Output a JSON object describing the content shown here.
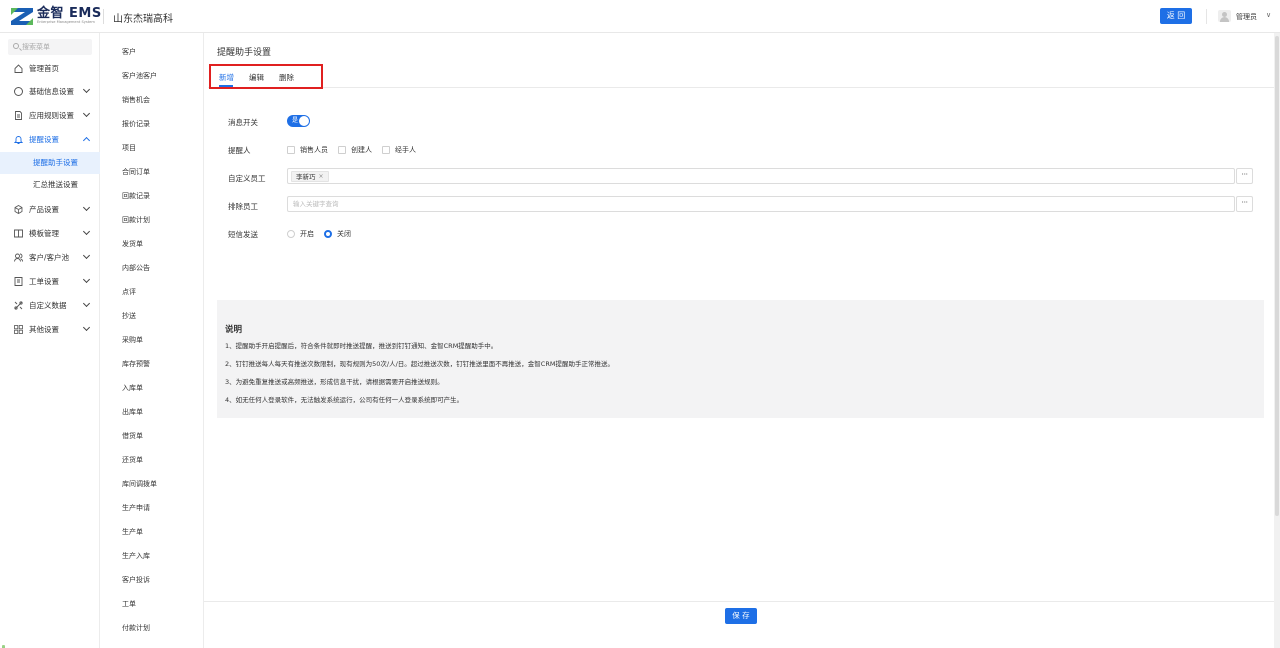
{
  "header": {
    "logo_main": "金智 EMS",
    "logo_sub": "Enterprise Management System",
    "company": "山东杰瑞高科",
    "back_label": "返 回",
    "user_name": "管理员",
    "user_caret": "∨"
  },
  "sidebar": {
    "search_placeholder": "搜索菜单",
    "items": [
      {
        "label": "管理首页",
        "icon": "home-icon"
      },
      {
        "label": "基础信息设置",
        "icon": "settings-circle-icon"
      },
      {
        "label": "应用规则设置",
        "icon": "document-icon"
      },
      {
        "label": "提醒设置",
        "icon": "bell-icon"
      },
      {
        "label": "产品设置",
        "icon": "cube-icon"
      },
      {
        "label": "模板管理",
        "icon": "template-icon"
      },
      {
        "label": "客户/客户池",
        "icon": "users-icon"
      },
      {
        "label": "工单设置",
        "icon": "ticket-icon"
      },
      {
        "label": "自定义数据",
        "icon": "custom-data-icon"
      },
      {
        "label": "其他设置",
        "icon": "grid-icon"
      }
    ],
    "sub_items": [
      "提醒助手设置",
      "汇总推送设置"
    ]
  },
  "midcol": {
    "items": [
      "客户",
      "客户池客户",
      "销售机会",
      "报价记录",
      "项目",
      "合同订单",
      "回款记录",
      "回款计划",
      "发货单",
      "内部公告",
      "点评",
      "抄送",
      "采购单",
      "库存预警",
      "入库单",
      "出库单",
      "借货单",
      "还货单",
      "库间调拨单",
      "生产申请",
      "生产单",
      "生产入库",
      "客户投诉",
      "工单",
      "付款计划"
    ]
  },
  "main": {
    "title": "提醒助手设置",
    "tabs": [
      "新增",
      "编辑",
      "删除"
    ],
    "form": {
      "switch_label": "消息开关",
      "switch_text": "是",
      "remind_label": "提醒人",
      "remind_options": [
        "销售人员",
        "创建人",
        "经手人"
      ],
      "custom_label": "自定义员工",
      "custom_tag": "李新巧",
      "tag_close": "×",
      "exclude_label": "排除员工",
      "exclude_placeholder": "输入关键字查询",
      "more_label": "···",
      "sms_label": "短信发送",
      "sms_options": [
        "开启",
        "关闭"
      ],
      "sms_selected": "关闭"
    },
    "notes": {
      "title": "说明",
      "lines": [
        "1、提醒助手开启提醒后，符合条件就即时推送提醒，推送到钉钉通知、金智CRM提醒助手中。",
        "2、钉钉推送每人每天有推送次数限制，现有规则为50次/人/日。超过推送次数，钉钉推送里面不再推送，金智CRM提醒助手正常推送。",
        "3、为避免重复推送或高频推送，形成信息干扰，请根据需要开启推送规则。",
        "4、如无任何人登录软件，无法触发系统运行，公司有任何一人登录系统即可产生。"
      ]
    },
    "save_label": "保 存"
  },
  "colors": {
    "accent": "#1e6fe6",
    "highlight": "#e02020",
    "selected_bg": "#e8f1fd"
  }
}
